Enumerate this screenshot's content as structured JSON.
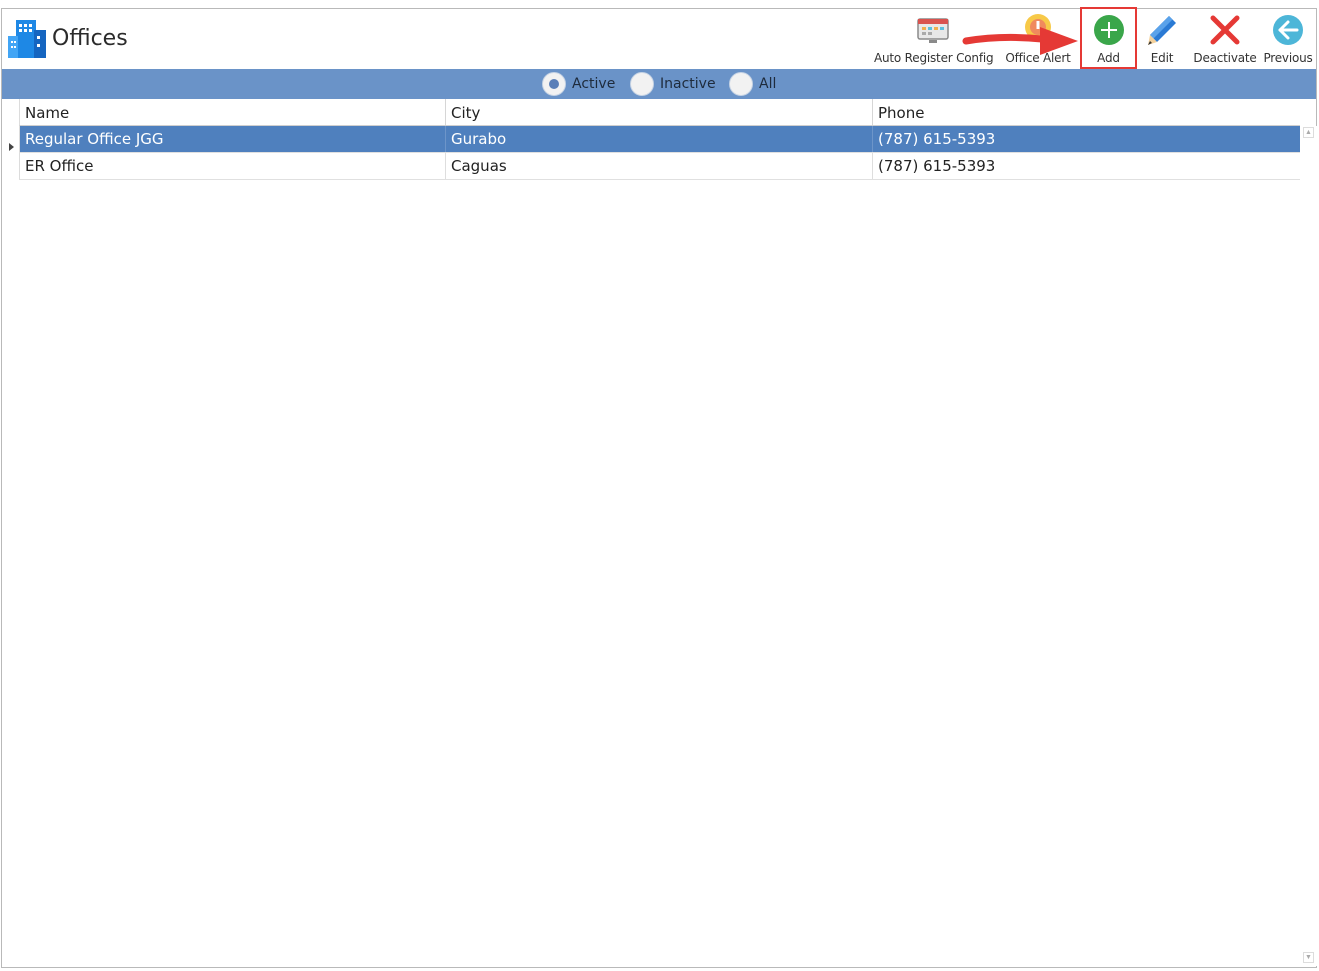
{
  "header": {
    "title": "Offices",
    "logo_icon": "office-buildings-icon"
  },
  "toolbar": {
    "auto_register_config": {
      "label": "Auto Register Config",
      "icon": "calendar-config-icon"
    },
    "office_alert": {
      "label": "Office Alert",
      "icon": "alert-icon"
    },
    "add": {
      "label": "Add",
      "icon": "plus-circle-icon"
    },
    "edit": {
      "label": "Edit",
      "icon": "pencil-icon"
    },
    "deactivate": {
      "label": "Deactivate",
      "icon": "x-icon"
    },
    "previous": {
      "label": "Previous",
      "icon": "arrow-left-circle-icon"
    }
  },
  "annotation": {
    "highlight_color": "#e53935",
    "target": "Add"
  },
  "filter": {
    "options": [
      {
        "label": "Active",
        "checked": true
      },
      {
        "label": "Inactive",
        "checked": false
      },
      {
        "label": "All",
        "checked": false
      }
    ]
  },
  "grid": {
    "columns": [
      "Name",
      "City",
      "Phone"
    ],
    "rows": [
      {
        "name": "Regular Office JGG",
        "city": "Gurabo",
        "phone": "(787) 615-5393",
        "selected": true
      },
      {
        "name": "ER Office",
        "city": "Caguas",
        "phone": "(787) 615-5393",
        "selected": false
      }
    ]
  },
  "colors": {
    "filter_bar": "#6a93c8",
    "selected_row": "#4f80be",
    "add_green": "#3aa64a",
    "deactivate_red": "#e53935",
    "edit_blue": "#2a7ad4",
    "previous_teal": "#4db6d8"
  }
}
